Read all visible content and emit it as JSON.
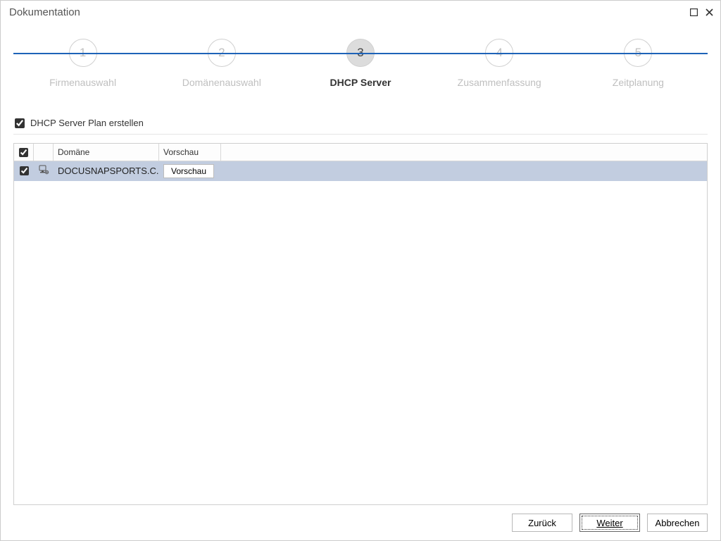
{
  "window": {
    "title": "Dokumentation"
  },
  "stepper": {
    "steps": [
      {
        "num": "1",
        "label": "Firmenauswahl"
      },
      {
        "num": "2",
        "label": "Domänenauswahl"
      },
      {
        "num": "3",
        "label": "DHCP Server"
      },
      {
        "num": "4",
        "label": "Zusammenfassung"
      },
      {
        "num": "5",
        "label": "Zeitplanung"
      }
    ]
  },
  "options": {
    "create_plan_label": "DHCP Server Plan erstellen"
  },
  "grid": {
    "headers": {
      "domain": "Domäne",
      "preview": "Vorschau"
    },
    "rows": [
      {
        "domain": "DOCUSNAPSPORTS.C...",
        "preview_label": "Vorschau"
      }
    ]
  },
  "footer": {
    "back": "Zurück",
    "next": "Weiter",
    "cancel": "Abbrechen"
  }
}
